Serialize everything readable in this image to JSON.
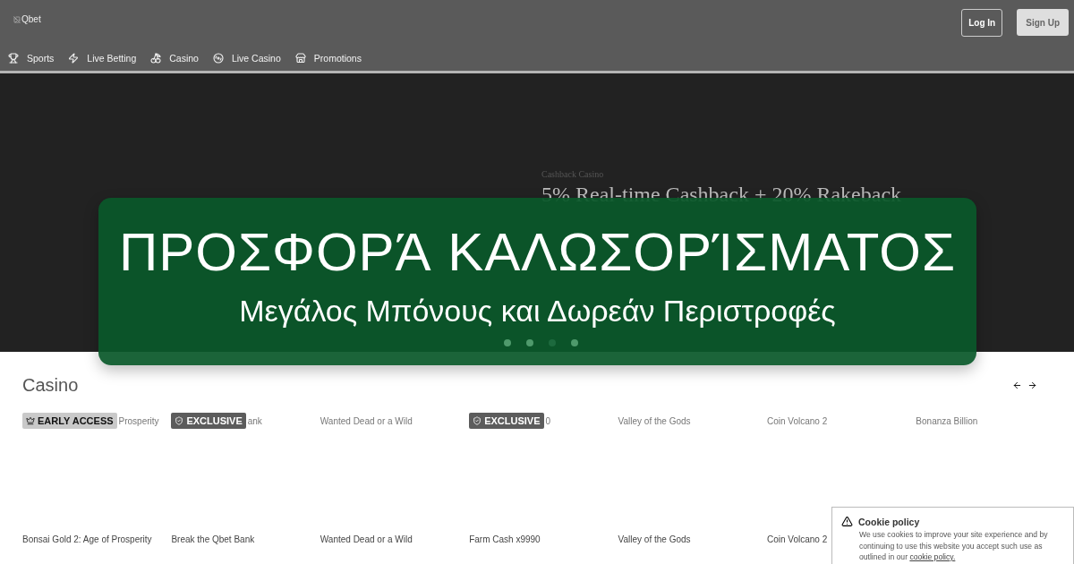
{
  "header": {
    "logo_alt": "Qbet",
    "buttons": [
      {
        "label": "Log In",
        "kind": "outline"
      },
      {
        "label": "Sign Up",
        "kind": "filled"
      }
    ]
  },
  "nav": [
    {
      "label": "Sports"
    },
    {
      "label": "Live Betting"
    },
    {
      "label": "Casino"
    },
    {
      "label": "Live Casino"
    },
    {
      "label": "Promotions"
    }
  ],
  "hero": {
    "eyebrow": "Cashback Casino",
    "title": "5% Real-time Cashback + 20% Rakeback",
    "dots": [
      {
        "selected": false
      },
      {
        "selected": false
      },
      {
        "selected": true
      },
      {
        "selected": false
      }
    ]
  },
  "overlay": {
    "title": "ΠΡΟΣΦΟΡΆ ΚΑΛΩΣΟΡΊΣΜΑΤΟΣ",
    "subtitle": "Μεγάλος Μπόνους και Δωρεάν Περιστροφές"
  },
  "casino": {
    "title": "Casino",
    "games": [
      {
        "alt": "Prosperity",
        "badge": {
          "kind": "early",
          "label": "EARLY ACCESS"
        },
        "name": "Bonsai Gold 2: Age of Prosperity"
      },
      {
        "alt": "ank",
        "badge": {
          "kind": "exclusive",
          "label": "EXCLUSIVE"
        },
        "name": "Break the Qbet Bank"
      },
      {
        "alt": "Wanted Dead or a Wild",
        "name": "Wanted Dead or a Wild"
      },
      {
        "alt": "0",
        "badge": {
          "kind": "exclusive",
          "label": "EXCLUSIVE"
        },
        "name": "Farm Cash x9990"
      },
      {
        "alt": "Valley of the Gods",
        "name": "Valley of the Gods"
      },
      {
        "alt": "Coin Volcano 2",
        "name": "Coin Volcano 2"
      },
      {
        "alt": "Bonanza Billion"
      }
    ]
  },
  "cookie": {
    "title": "Cookie policy",
    "text": "We use cookies to improve your site experience and by continuing to use this website you accept such use as outlined in our",
    "link": "cookie policy."
  }
}
